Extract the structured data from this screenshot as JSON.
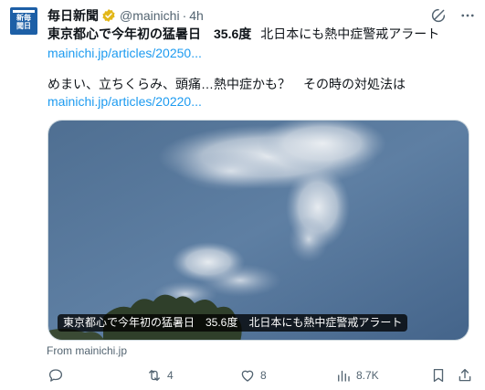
{
  "tweet": {
    "avatar": {
      "text": "新毎聞日"
    },
    "display_name": "毎日新聞",
    "handle": "@mainichi",
    "dot": "·",
    "time": "4h",
    "line1_bold": "東京都心で今年初の猛暑日　35.6度",
    "line1_rest": "北日本にも熱中症警戒アラート",
    "link1": "mainichi.jp/articles/20250...",
    "line2": "めまい、立ちくらみ、頭痛…熱中症かも？　その時の対処法は",
    "link2": "mainichi.jp/articles/20220...",
    "card": {
      "caption": "東京都心で今年初の猛暑日　35.6度　北日本にも熱中症警戒アラート"
    },
    "from_text": "From mainichi.jp",
    "actions": {
      "reply_count": "",
      "retweet_count": "4",
      "like_count": "8",
      "views_count": "8.7K"
    }
  },
  "colors": {
    "text": "#0f1419",
    "secondary": "#536471",
    "link": "#1d9bf0",
    "verified_gold": "#e2b719",
    "avatar_blue": "#1d5fa6"
  },
  "icons": {
    "verified": "verified-badge-icon",
    "grok": "grok-icon",
    "more": "more-icon",
    "reply": "reply-icon",
    "retweet": "retweet-icon",
    "like": "like-icon",
    "views": "views-icon",
    "bookmark": "bookmark-icon",
    "share": "share-icon"
  }
}
